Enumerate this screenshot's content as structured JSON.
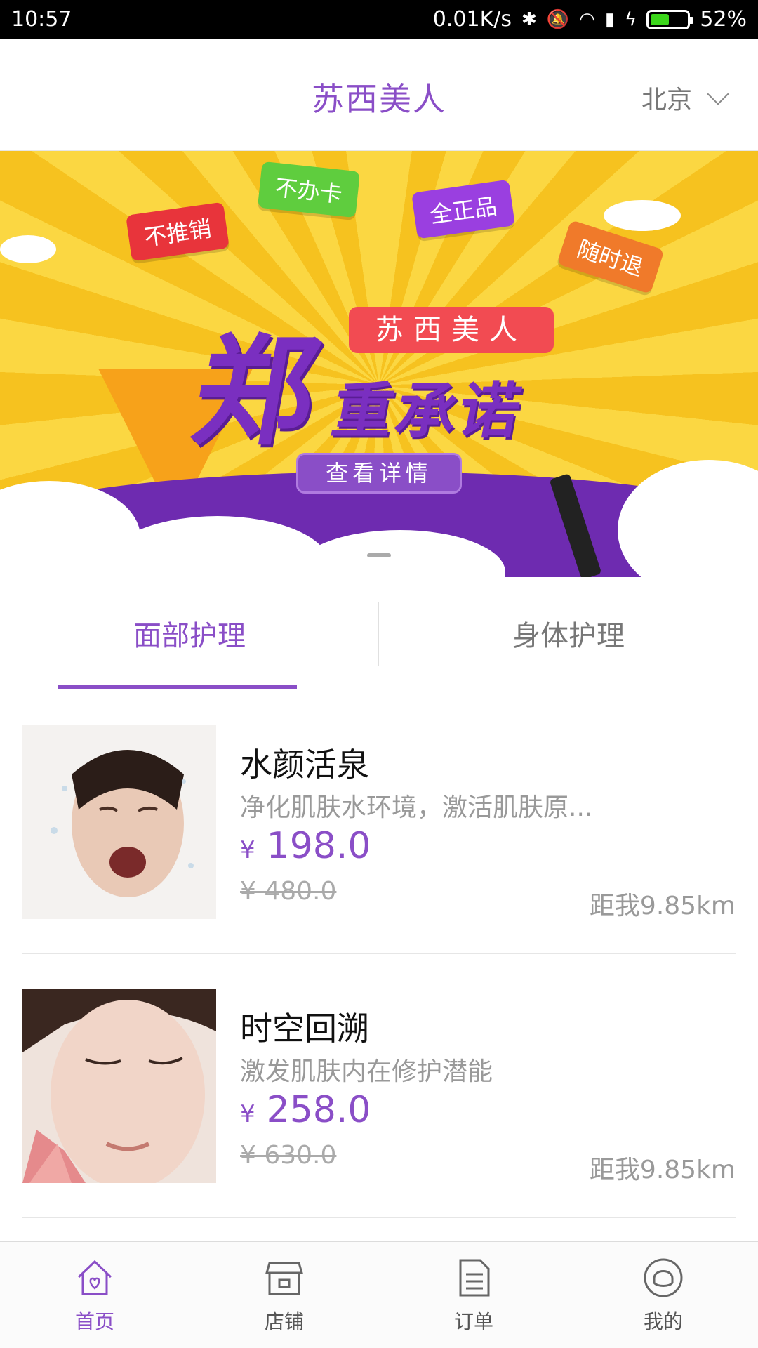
{
  "status_bar": {
    "time": "10:57",
    "speed": "0.01K/s",
    "battery": "52%",
    "battery_level": 0.52
  },
  "header": {
    "title": "苏西美人",
    "city": "北京"
  },
  "banner": {
    "tags": [
      "不推销",
      "不办卡",
      "全正品",
      "随时退"
    ],
    "brand": "苏西美人",
    "headline_big": "郑",
    "headline_rest": "重承诺",
    "button": "查看详情"
  },
  "tabs": [
    {
      "label": "面部护理",
      "active": true
    },
    {
      "label": "身体护理",
      "active": false
    }
  ],
  "products": [
    {
      "name": "水颜活泉",
      "description": "净化肌肤水环境，激活肌肤原...",
      "currency": "¥",
      "price": "198.0",
      "old_price": "¥ 480.0",
      "distance": "距我9.85km"
    },
    {
      "name": "时空回溯",
      "description": "激发肌肤内在修护潜能",
      "currency": "¥",
      "price": "258.0",
      "old_price": "¥ 630.0",
      "distance": "距我9.85km"
    }
  ],
  "bottom_nav": [
    {
      "label": "首页",
      "icon": "home-icon",
      "active": true
    },
    {
      "label": "店铺",
      "icon": "store-icon",
      "active": false
    },
    {
      "label": "订单",
      "icon": "order-icon",
      "active": false
    },
    {
      "label": "我的",
      "icon": "profile-icon",
      "active": false
    }
  ],
  "colors": {
    "accent": "#8a4ec7",
    "banner_yellow": "#f9cb2a",
    "banner_purple": "#6e2bb0"
  }
}
